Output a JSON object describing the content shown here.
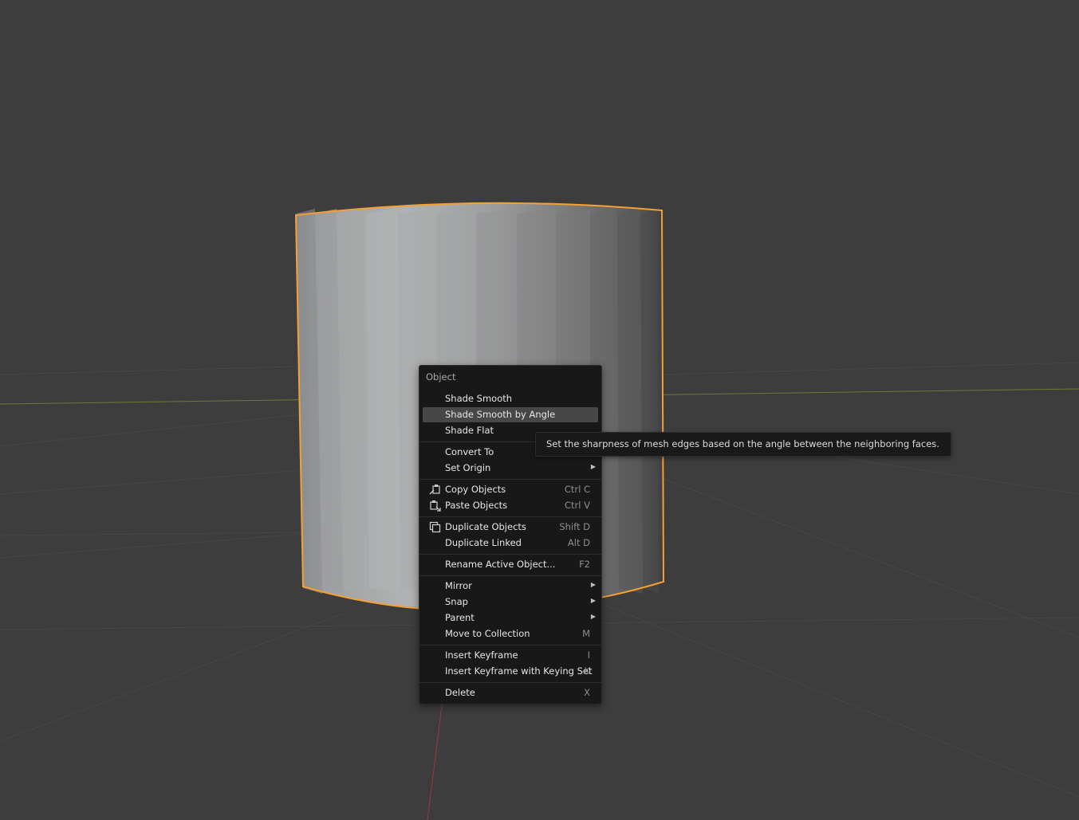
{
  "context_menu": {
    "title": "Object",
    "items": [
      {
        "label": "Shade Smooth",
        "shortcut": "",
        "submenu": false,
        "active": false,
        "icon": ""
      },
      {
        "label": "Shade Smooth by Angle",
        "shortcut": "",
        "submenu": false,
        "active": true,
        "icon": ""
      },
      {
        "label": "Shade Flat",
        "shortcut": "",
        "submenu": false,
        "active": false,
        "icon": ""
      },
      {
        "label": "Convert To",
        "shortcut": "",
        "submenu": true,
        "active": false,
        "icon": ""
      },
      {
        "label": "Set Origin",
        "shortcut": "",
        "submenu": true,
        "active": false,
        "icon": ""
      },
      {
        "label": "Copy Objects",
        "shortcut": "Ctrl C",
        "submenu": false,
        "active": false,
        "icon": "copy-icon"
      },
      {
        "label": "Paste Objects",
        "shortcut": "Ctrl V",
        "submenu": false,
        "active": false,
        "icon": "paste-icon"
      },
      {
        "label": "Duplicate Objects",
        "shortcut": "Shift D",
        "submenu": false,
        "active": false,
        "icon": "duplicate-icon"
      },
      {
        "label": "Duplicate Linked",
        "shortcut": "Alt D",
        "submenu": false,
        "active": false,
        "icon": ""
      },
      {
        "label": "Rename Active Object...",
        "shortcut": "F2",
        "submenu": false,
        "active": false,
        "icon": ""
      },
      {
        "label": "Mirror",
        "shortcut": "",
        "submenu": true,
        "active": false,
        "icon": ""
      },
      {
        "label": "Snap",
        "shortcut": "",
        "submenu": true,
        "active": false,
        "icon": ""
      },
      {
        "label": "Parent",
        "shortcut": "",
        "submenu": true,
        "active": false,
        "icon": ""
      },
      {
        "label": "Move to Collection",
        "shortcut": "M",
        "submenu": false,
        "active": false,
        "icon": ""
      },
      {
        "label": "Insert Keyframe",
        "shortcut": "I",
        "submenu": false,
        "active": false,
        "icon": ""
      },
      {
        "label": "Insert Keyframe with Keying Set",
        "shortcut": "K",
        "submenu": false,
        "active": false,
        "icon": ""
      },
      {
        "label": "Delete",
        "shortcut": "X",
        "submenu": false,
        "active": false,
        "icon": ""
      }
    ],
    "submenu_arrow": "▶"
  },
  "tooltip": {
    "text": "Set the sharpness of mesh edges based on the angle between the neighboring faces."
  },
  "viewport": {
    "background_color": "#3d3d3d",
    "selection_outline_color": "#f5a033",
    "x_axis_color": "#9b3a3f",
    "y_axis_color": "#6e7b34"
  }
}
